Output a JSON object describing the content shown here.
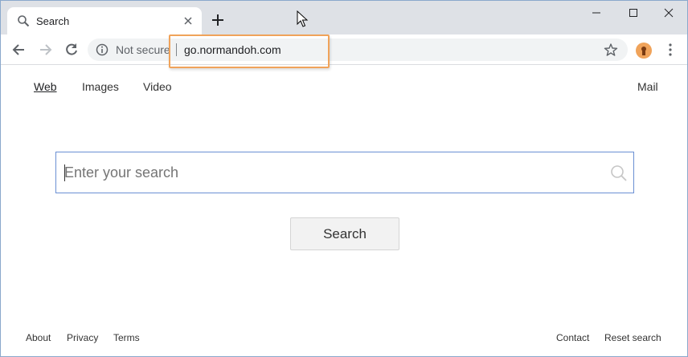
{
  "browser": {
    "tab_title": "Search",
    "new_tab_symbol": "+",
    "security_label": "Not secure",
    "url": "go.normandoh.com",
    "icons": {
      "tab": "search-icon",
      "back": "arrow-left-icon",
      "forward": "arrow-right-icon",
      "reload": "reload-icon",
      "info": "info-icon",
      "bookmark": "star-icon",
      "menu": "kebab-menu-icon"
    },
    "highlight_color": "#f0a35a"
  },
  "nav": {
    "web": "Web",
    "images": "Images",
    "video": "Video",
    "mail": "Mail"
  },
  "search": {
    "placeholder": "Enter your search",
    "value": "",
    "button_label": "Search",
    "border_color": "#6a8fd3"
  },
  "footer": {
    "about": "About",
    "privacy": "Privacy",
    "terms": "Terms",
    "contact": "Contact",
    "reset": "Reset search"
  }
}
